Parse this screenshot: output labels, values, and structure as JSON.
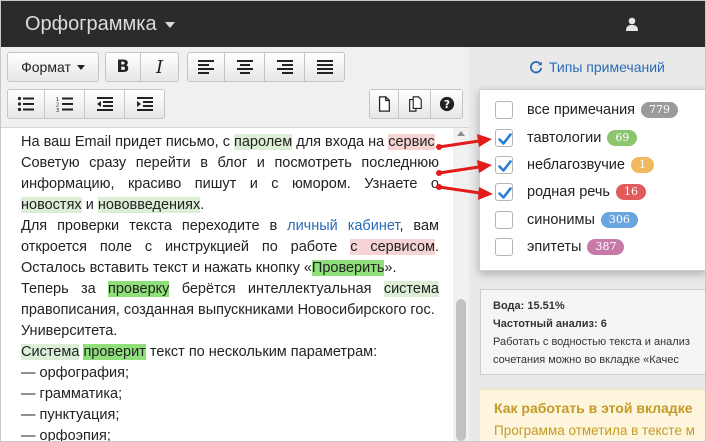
{
  "app": {
    "title": "Орфограммка"
  },
  "toolbar": {
    "format_label": "Формат",
    "bold_label": "B",
    "italic_label": "I"
  },
  "editor": {
    "lines": {
      "l1a": "На ваш Email придет письмо, с ",
      "l1b": "паролем",
      "l1c": " для входа на ",
      "l1d": "сервис",
      "l2": "Советую сразу перейти в блог и посмотреть последнюю",
      "l3": "информацию, красиво пишут и с юмором. Узнаете о",
      "l4a": "новостях",
      "l4b": " и ",
      "l4c": "нововведениях",
      "l4d": ".",
      "l5a": "Для проверки текста переходите в ",
      "l5b": "личный кабинет",
      "l5c": ", вам",
      "l6a": "откроется поле с инструкцией по работе ",
      "l6b": "с ",
      "l6c": "сервисом",
      "l6d": ".",
      "l7a": "Осталось вставить текст и нажать кнопку «",
      "l7b": "Проверить",
      "l7c": "».",
      "l8a": "Теперь за ",
      "l8b": "проверку",
      "l8c": " берётся интеллектуальная ",
      "l8d": "система",
      "l9": "правописания, созданная выпускниками Новосибирского гос.",
      "l10": "Университета.",
      "l11a": "Система",
      "l11b": " ",
      "l11c": "проверит",
      "l11d": " текст по нескольким параметрам:",
      "l12": "— орфография;",
      "l13": "— грамматика;",
      "l14": "— пунктуация;",
      "l15": "— орфоэпия;"
    }
  },
  "notes": {
    "title": "Типы примечаний",
    "items": [
      {
        "label": "все примечания",
        "count": "779",
        "checked": false,
        "color": "#9a9a9a"
      },
      {
        "label": "тавтологии",
        "count": "69",
        "checked": true,
        "color": "#8cc56e"
      },
      {
        "label": "неблагозвучие",
        "count": "1",
        "checked": true,
        "color": "#f0b95e"
      },
      {
        "label": "родная речь",
        "count": "16",
        "checked": true,
        "color": "#e05c5c"
      },
      {
        "label": "синонимы",
        "count": "306",
        "checked": false,
        "color": "#6aa5e0"
      },
      {
        "label": "эпитеты",
        "count": "387",
        "checked": false,
        "color": "#c77aa8"
      }
    ]
  },
  "info": {
    "water": "Вода: 15.51%",
    "freq": "Частотный анализ: 6",
    "line1": "Работать с водностью текста и анализ",
    "line2": "сочетания можно во вкладке «Качес"
  },
  "howto": {
    "heading": "Как работать в этой вкладке",
    "text": "Программа отметила в тексте м"
  },
  "colors": {
    "navbar": "#2b2b2b",
    "link": "#2a6bb8",
    "arrow": "#e21b1b",
    "check": "#2a7fd4",
    "highlight_green": "#dcefd6",
    "highlight_red": "#f7d4d4",
    "highlight_strong": "#8fe07a"
  }
}
